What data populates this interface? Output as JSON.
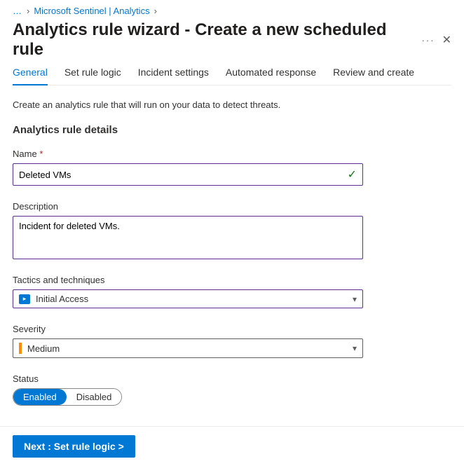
{
  "breadcrumb": {
    "dots": "…",
    "link": "Microsoft Sentinel | Analytics"
  },
  "page": {
    "title": "Analytics rule wizard - Create a new scheduled rule"
  },
  "tabs": {
    "general": "General",
    "logic": "Set rule logic",
    "incident": "Incident settings",
    "automated": "Automated response",
    "review": "Review and create"
  },
  "intro": "Create an analytics rule that will run on your data to detect threats.",
  "section_title": "Analytics rule details",
  "fields": {
    "name_label": "Name",
    "name_value": "Deleted VMs",
    "desc_label": "Description",
    "desc_value": "Incident for deleted VMs.",
    "tactics_label": "Tactics and techniques",
    "tactics_value": "Initial Access",
    "severity_label": "Severity",
    "severity_value": "Medium",
    "status_label": "Status",
    "status_enabled": "Enabled",
    "status_disabled": "Disabled"
  },
  "footer": {
    "next": "Next : Set rule logic >"
  }
}
